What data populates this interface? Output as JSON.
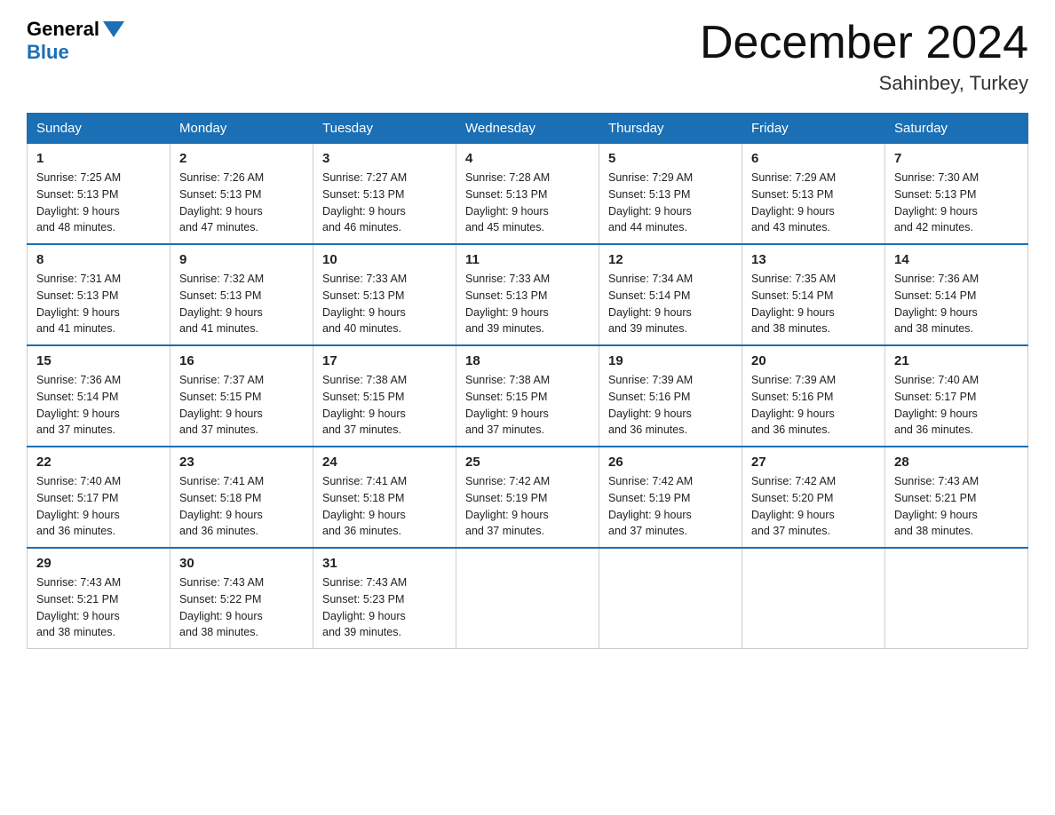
{
  "logo": {
    "general": "General",
    "blue": "Blue"
  },
  "title": "December 2024",
  "location": "Sahinbey, Turkey",
  "days_of_week": [
    "Sunday",
    "Monday",
    "Tuesday",
    "Wednesday",
    "Thursday",
    "Friday",
    "Saturday"
  ],
  "weeks": [
    [
      {
        "day": "1",
        "sunrise": "7:25 AM",
        "sunset": "5:13 PM",
        "daylight": "9 hours and 48 minutes."
      },
      {
        "day": "2",
        "sunrise": "7:26 AM",
        "sunset": "5:13 PM",
        "daylight": "9 hours and 47 minutes."
      },
      {
        "day": "3",
        "sunrise": "7:27 AM",
        "sunset": "5:13 PM",
        "daylight": "9 hours and 46 minutes."
      },
      {
        "day": "4",
        "sunrise": "7:28 AM",
        "sunset": "5:13 PM",
        "daylight": "9 hours and 45 minutes."
      },
      {
        "day": "5",
        "sunrise": "7:29 AM",
        "sunset": "5:13 PM",
        "daylight": "9 hours and 44 minutes."
      },
      {
        "day": "6",
        "sunrise": "7:29 AM",
        "sunset": "5:13 PM",
        "daylight": "9 hours and 43 minutes."
      },
      {
        "day": "7",
        "sunrise": "7:30 AM",
        "sunset": "5:13 PM",
        "daylight": "9 hours and 42 minutes."
      }
    ],
    [
      {
        "day": "8",
        "sunrise": "7:31 AM",
        "sunset": "5:13 PM",
        "daylight": "9 hours and 41 minutes."
      },
      {
        "day": "9",
        "sunrise": "7:32 AM",
        "sunset": "5:13 PM",
        "daylight": "9 hours and 41 minutes."
      },
      {
        "day": "10",
        "sunrise": "7:33 AM",
        "sunset": "5:13 PM",
        "daylight": "9 hours and 40 minutes."
      },
      {
        "day": "11",
        "sunrise": "7:33 AM",
        "sunset": "5:13 PM",
        "daylight": "9 hours and 39 minutes."
      },
      {
        "day": "12",
        "sunrise": "7:34 AM",
        "sunset": "5:14 PM",
        "daylight": "9 hours and 39 minutes."
      },
      {
        "day": "13",
        "sunrise": "7:35 AM",
        "sunset": "5:14 PM",
        "daylight": "9 hours and 38 minutes."
      },
      {
        "day": "14",
        "sunrise": "7:36 AM",
        "sunset": "5:14 PM",
        "daylight": "9 hours and 38 minutes."
      }
    ],
    [
      {
        "day": "15",
        "sunrise": "7:36 AM",
        "sunset": "5:14 PM",
        "daylight": "9 hours and 37 minutes."
      },
      {
        "day": "16",
        "sunrise": "7:37 AM",
        "sunset": "5:15 PM",
        "daylight": "9 hours and 37 minutes."
      },
      {
        "day": "17",
        "sunrise": "7:38 AM",
        "sunset": "5:15 PM",
        "daylight": "9 hours and 37 minutes."
      },
      {
        "day": "18",
        "sunrise": "7:38 AM",
        "sunset": "5:15 PM",
        "daylight": "9 hours and 37 minutes."
      },
      {
        "day": "19",
        "sunrise": "7:39 AM",
        "sunset": "5:16 PM",
        "daylight": "9 hours and 36 minutes."
      },
      {
        "day": "20",
        "sunrise": "7:39 AM",
        "sunset": "5:16 PM",
        "daylight": "9 hours and 36 minutes."
      },
      {
        "day": "21",
        "sunrise": "7:40 AM",
        "sunset": "5:17 PM",
        "daylight": "9 hours and 36 minutes."
      }
    ],
    [
      {
        "day": "22",
        "sunrise": "7:40 AM",
        "sunset": "5:17 PM",
        "daylight": "9 hours and 36 minutes."
      },
      {
        "day": "23",
        "sunrise": "7:41 AM",
        "sunset": "5:18 PM",
        "daylight": "9 hours and 36 minutes."
      },
      {
        "day": "24",
        "sunrise": "7:41 AM",
        "sunset": "5:18 PM",
        "daylight": "9 hours and 36 minutes."
      },
      {
        "day": "25",
        "sunrise": "7:42 AM",
        "sunset": "5:19 PM",
        "daylight": "9 hours and 37 minutes."
      },
      {
        "day": "26",
        "sunrise": "7:42 AM",
        "sunset": "5:19 PM",
        "daylight": "9 hours and 37 minutes."
      },
      {
        "day": "27",
        "sunrise": "7:42 AM",
        "sunset": "5:20 PM",
        "daylight": "9 hours and 37 minutes."
      },
      {
        "day": "28",
        "sunrise": "7:43 AM",
        "sunset": "5:21 PM",
        "daylight": "9 hours and 38 minutes."
      }
    ],
    [
      {
        "day": "29",
        "sunrise": "7:43 AM",
        "sunset": "5:21 PM",
        "daylight": "9 hours and 38 minutes."
      },
      {
        "day": "30",
        "sunrise": "7:43 AM",
        "sunset": "5:22 PM",
        "daylight": "9 hours and 38 minutes."
      },
      {
        "day": "31",
        "sunrise": "7:43 AM",
        "sunset": "5:23 PM",
        "daylight": "9 hours and 39 minutes."
      },
      null,
      null,
      null,
      null
    ]
  ],
  "labels": {
    "sunrise": "Sunrise:",
    "sunset": "Sunset:",
    "daylight": "Daylight:"
  }
}
